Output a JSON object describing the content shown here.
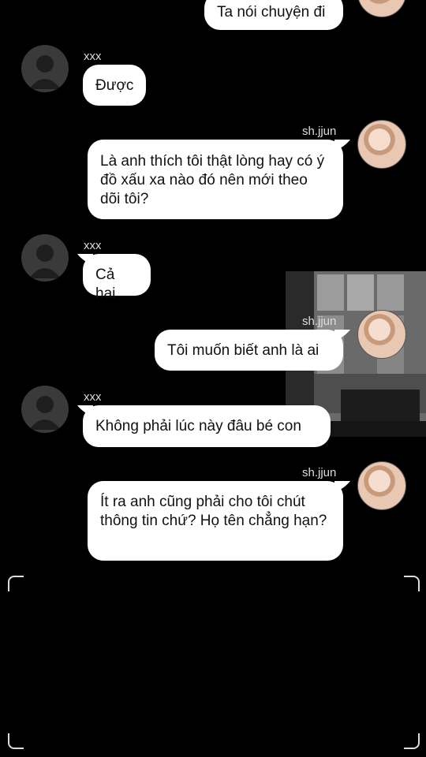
{
  "messages": [
    {
      "sender": "",
      "text": "Ta nói chuyện đi"
    },
    {
      "sender": "xxx",
      "text": "Được"
    },
    {
      "sender": "sh.jjun",
      "text": " Là anh thích tôi thật lòng hay có ý đồ xấu xa nào đó nên mới theo dõi tôi?"
    },
    {
      "sender": "xxx",
      "text": "Cả hai"
    },
    {
      "sender": "sh.jjun",
      "text": "Tôi muốn biết anh là ai"
    },
    {
      "sender": "xxx",
      "text": "Không phải lúc này đâu bé con"
    },
    {
      "sender": "sh.jjun",
      "text": " Ít ra anh cũng phải cho tôi chút thông tin chứ? Họ tên chẳng hạn?"
    }
  ]
}
